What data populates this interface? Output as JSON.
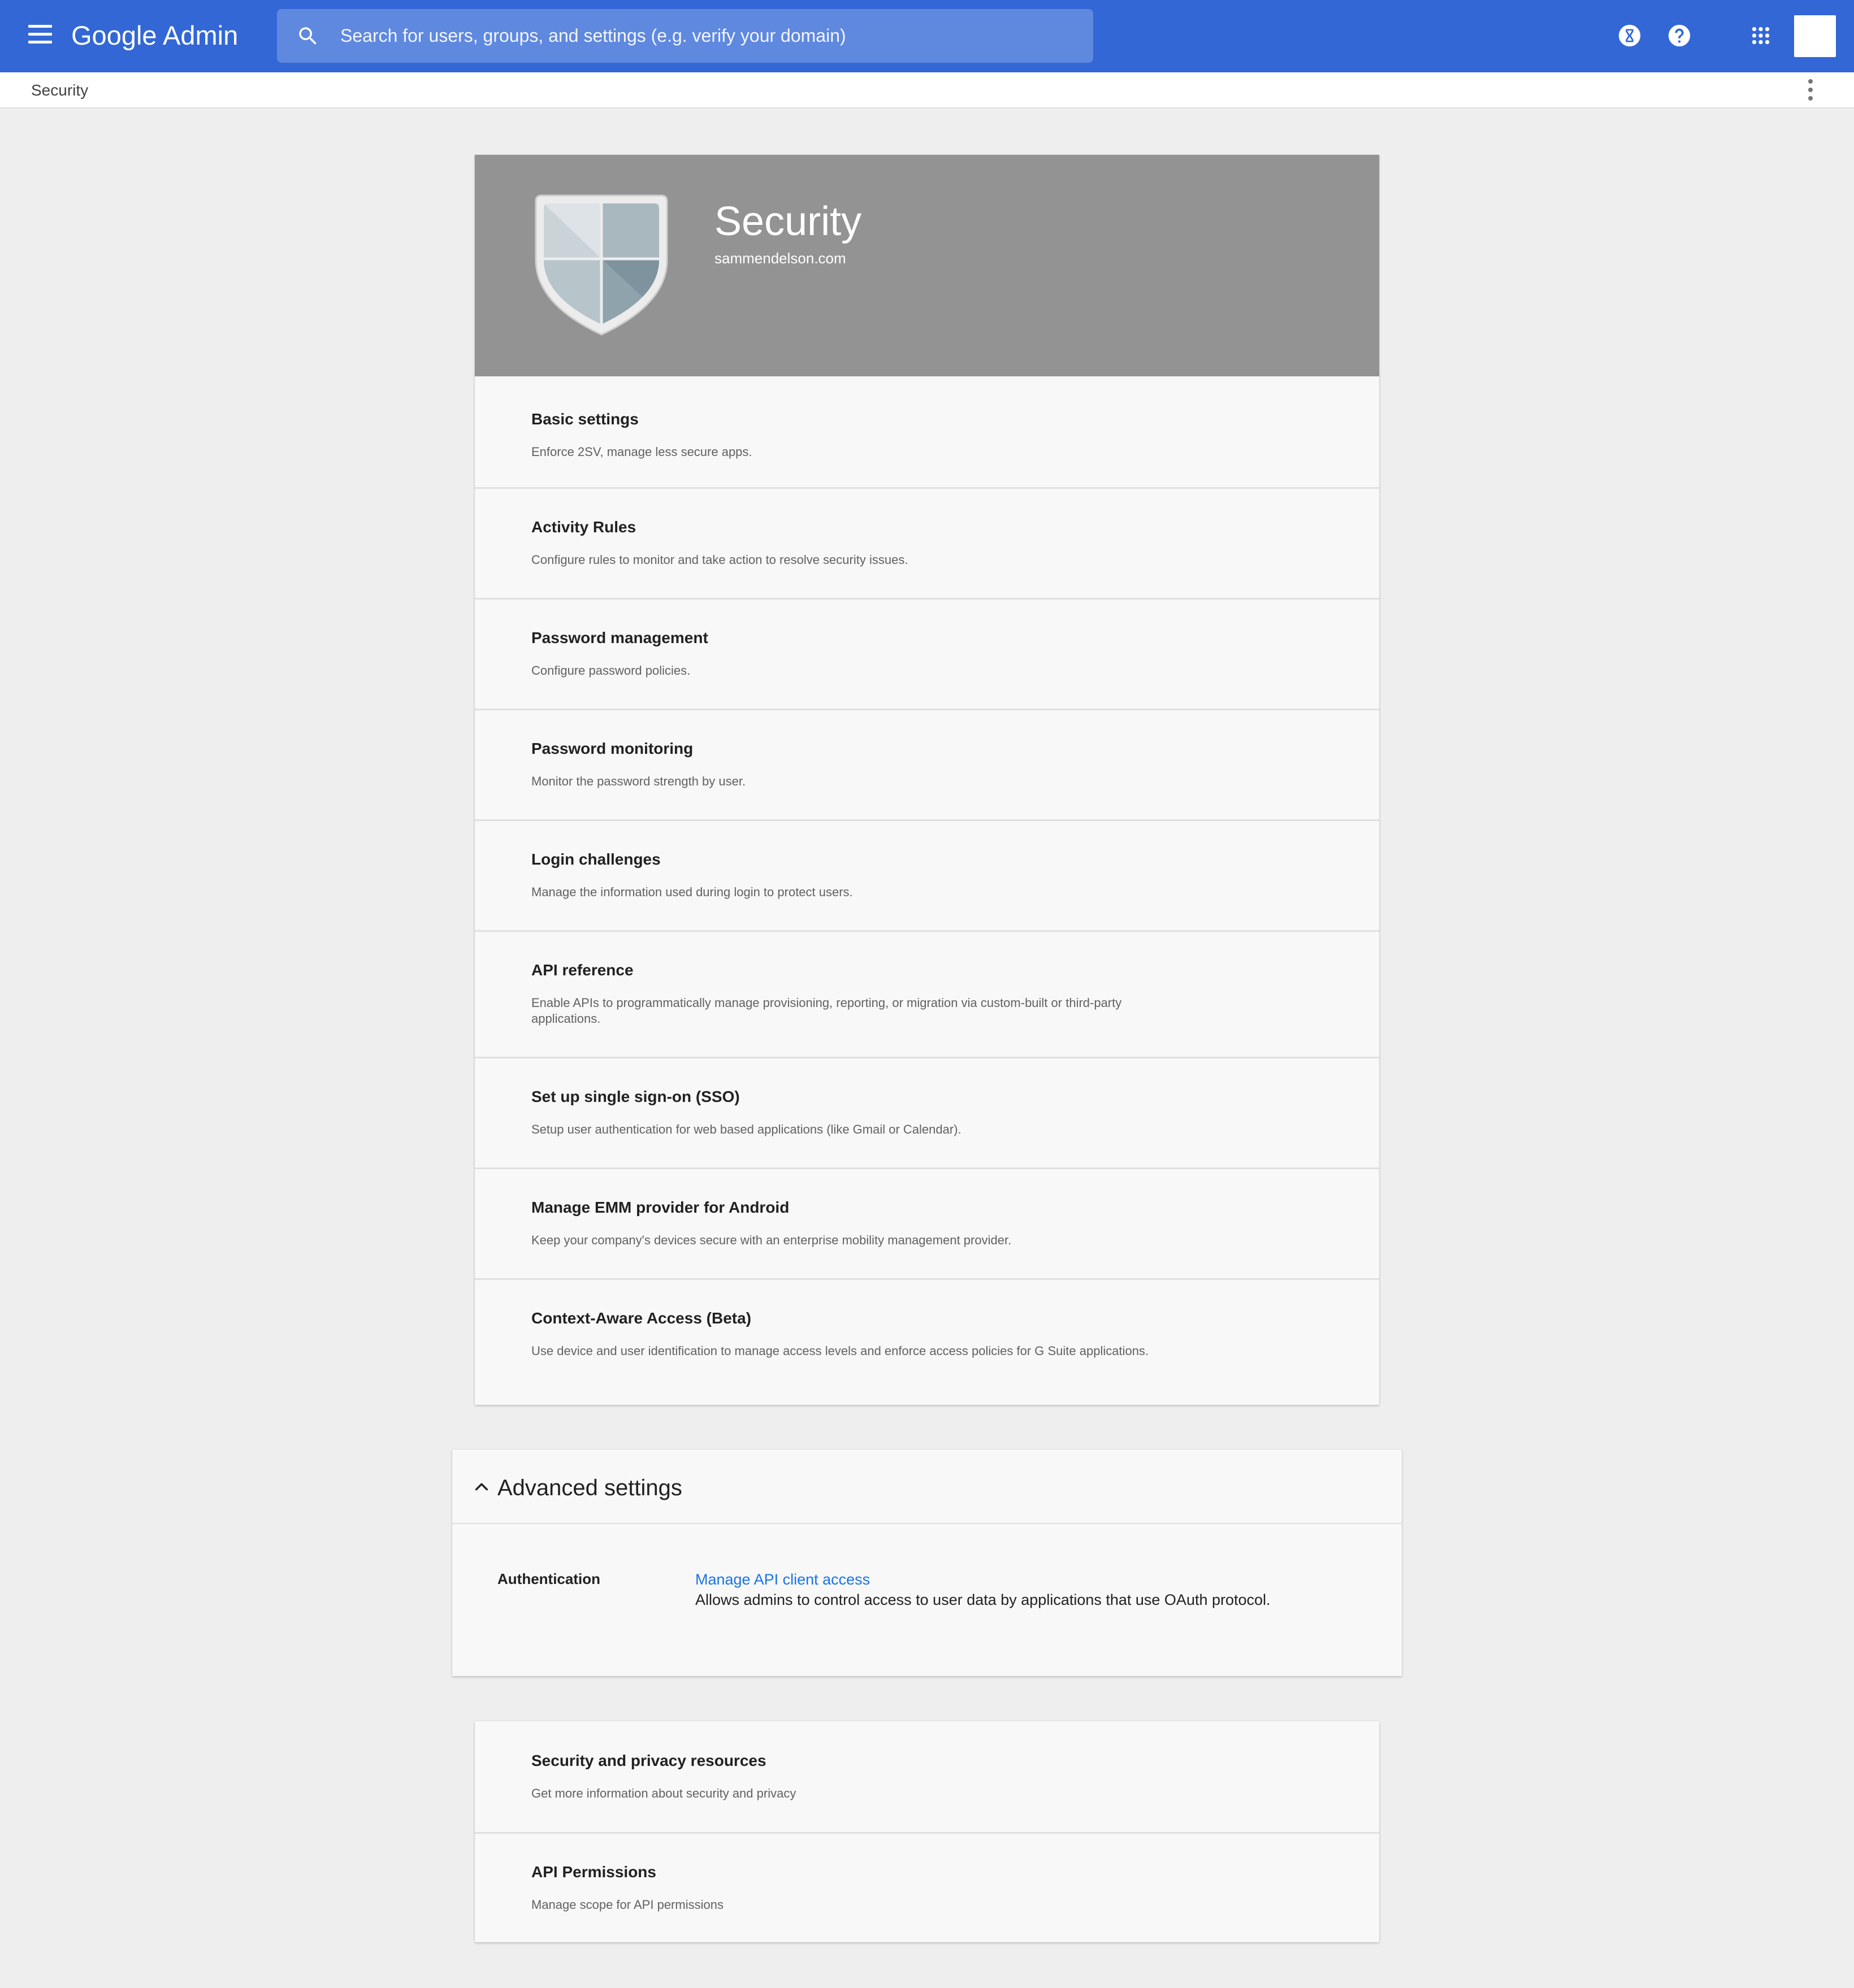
{
  "appbar": {
    "brand": "Google Admin",
    "search_placeholder": "Search for users, groups, and settings (e.g. verify your domain)"
  },
  "breadcrumb": "Security",
  "hero": {
    "title": "Security",
    "domain": "sammendelson.com"
  },
  "security_items": [
    {
      "title": "Basic settings",
      "description": "Enforce 2SV, manage less secure apps."
    },
    {
      "title": "Activity Rules",
      "description": "Configure rules to monitor and take action to resolve security issues."
    },
    {
      "title": "Password management",
      "description": "Configure password policies."
    },
    {
      "title": "Password monitoring",
      "description": "Monitor the password strength by user."
    },
    {
      "title": "Login challenges",
      "description": "Manage the information used during login to protect users."
    },
    {
      "title": "API reference",
      "description": "Enable APIs to programmatically manage provisioning, reporting, or migration via custom-built or third-party applications."
    },
    {
      "title": "Set up single sign-on (SSO)",
      "description": "Setup user authentication for web based applications (like Gmail or Calendar)."
    },
    {
      "title": "Manage EMM provider for Android",
      "description": "Keep your company's devices secure with an enterprise mobility management provider."
    },
    {
      "title": "Context-Aware Access (Beta)",
      "description": "Use device and user identification to manage access levels and enforce access policies for G Suite applications."
    }
  ],
  "advanced": {
    "title": "Advanced settings",
    "section_label": "Authentication",
    "link": "Manage API client access",
    "description": "Allows admins to control access to user data by applications that use OAuth protocol."
  },
  "resources": [
    {
      "title": "Security and privacy resources",
      "description": "Get more information about security and privacy"
    },
    {
      "title": "API Permissions",
      "description": "Manage scope for API permissions"
    }
  ],
  "colors": {
    "appbar": "#3367d6",
    "hero": "#939393",
    "link": "#1a73e8"
  }
}
